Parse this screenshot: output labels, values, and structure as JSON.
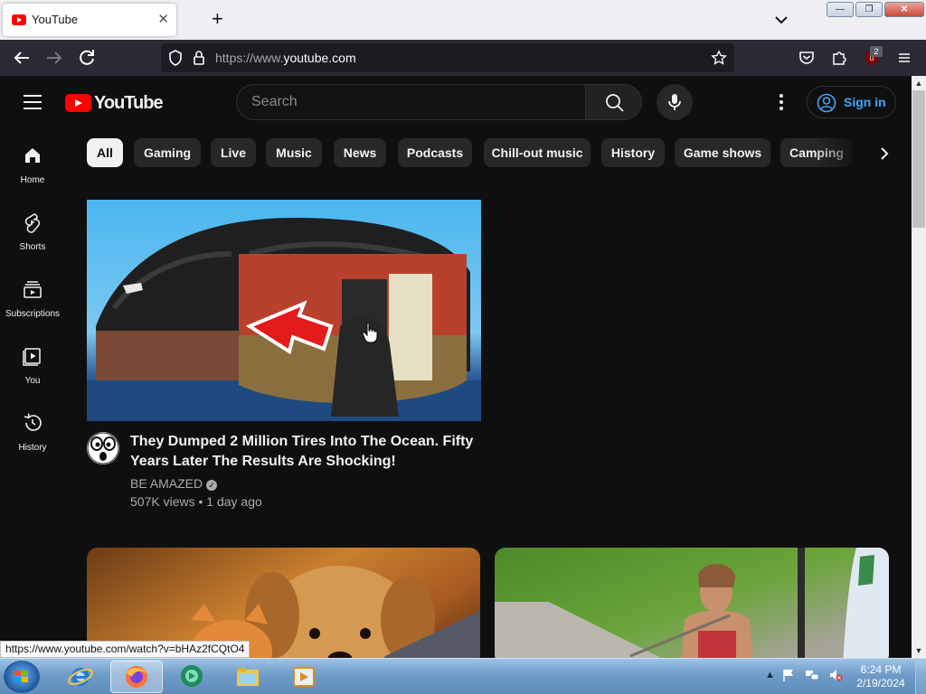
{
  "browser": {
    "tab_title": "YouTube",
    "tab_close": "✕",
    "new_tab": "+",
    "url_prefix": "https://www.",
    "url_domain": "youtube.com",
    "extension_badge": "2",
    "window_buttons": [
      "—",
      "❐",
      "✕"
    ]
  },
  "header": {
    "logo_text": "YouTube",
    "search_placeholder": "Search",
    "sign_in": "Sign in"
  },
  "sidebar": {
    "items": [
      {
        "label": "Home",
        "icon": "home-icon"
      },
      {
        "label": "Shorts",
        "icon": "shorts-icon"
      },
      {
        "label": "Subscriptions",
        "icon": "subscriptions-icon"
      },
      {
        "label": "You",
        "icon": "you-icon"
      },
      {
        "label": "History",
        "icon": "history-icon"
      }
    ]
  },
  "chips": [
    "All",
    "Gaming",
    "Live",
    "Music",
    "News",
    "Podcasts",
    "Chill-out music",
    "History",
    "Game shows",
    "Camping"
  ],
  "videos": [
    {
      "title": "They Dumped 2 Million Tires Into The Ocean. Fifty Years Later The Results Are Shocking!",
      "channel": "BE AMAZED",
      "meta": "507K views • 1 day ago"
    }
  ],
  "status_url": "https://www.youtube.com/watch?v=bHAz2fCQtO4",
  "taskbar": {
    "time": "6:24 PM",
    "date": "2/19/2024"
  },
  "colors": {
    "background": "#0f0f0f",
    "brand_red": "#ff0000",
    "link_blue": "#3ea6ff"
  }
}
